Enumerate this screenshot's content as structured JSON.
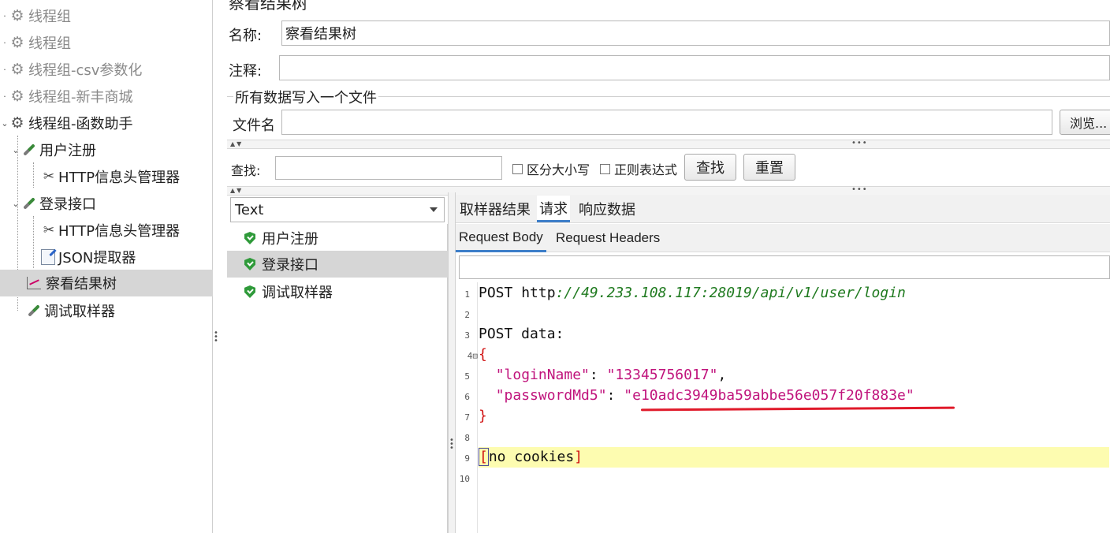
{
  "tree": {
    "items": [
      {
        "label": "线程组",
        "icon": "gear-icon",
        "state": "disabled"
      },
      {
        "label": "线程组",
        "icon": "gear-icon",
        "state": "disabled"
      },
      {
        "label": "线程组-csv参数化",
        "icon": "gear-icon",
        "state": "disabled"
      },
      {
        "label": "线程组-新丰商城",
        "icon": "gear-icon",
        "state": "disabled"
      },
      {
        "label": "线程组-函数助手",
        "icon": "gear-icon",
        "state": "expanded"
      },
      {
        "label": "用户注册",
        "icon": "pipette-icon",
        "state": "expanded"
      },
      {
        "label": "HTTP信息头管理器",
        "icon": "tools-icon",
        "state": "leaf"
      },
      {
        "label": "登录接口",
        "icon": "pipette-icon",
        "state": "expanded"
      },
      {
        "label": "HTTP信息头管理器",
        "icon": "tools-icon",
        "state": "leaf"
      },
      {
        "label": "JSON提取器",
        "icon": "json-extractor-icon",
        "state": "leaf"
      },
      {
        "label": "察看结果树",
        "icon": "graph-icon",
        "state": "selected"
      },
      {
        "label": "调试取样器",
        "icon": "pipette-icon",
        "state": "leaf"
      }
    ]
  },
  "panel": {
    "title": "察看结果树",
    "name_label": "名称:",
    "name_value": "察看结果树",
    "comment_label": "注释:",
    "comment_value": "",
    "group_title": "所有数据写入一个文件",
    "filename_label": "文件名",
    "filename_value": "",
    "browse_button": "浏览..."
  },
  "search": {
    "label": "查找:",
    "value": "",
    "case_sensitive": "区分大小写",
    "regex": "正则表达式",
    "find_button": "查找",
    "reset_button": "重置"
  },
  "results": {
    "render_mode": "Text",
    "samples": [
      {
        "label": "用户注册",
        "status": "success"
      },
      {
        "label": "登录接口",
        "status": "success",
        "selected": true
      },
      {
        "label": "调试取样器",
        "status": "success"
      }
    ]
  },
  "tabs": {
    "items": [
      "取样器结果",
      "请求",
      "响应数据"
    ],
    "active": "请求",
    "sub_items": [
      "Request Body",
      "Request Headers"
    ],
    "sub_active": "Request Body"
  },
  "code": {
    "line_numbers": [
      "1",
      "2",
      "3",
      "4⊟",
      "5",
      "6",
      "7",
      "8",
      "9",
      "10"
    ],
    "method": "POST",
    "url_scheme": "http",
    "url_rest": "://49.233.108.117:28019/api/v1/user/login",
    "post_data_label": "POST data:",
    "open_brace": "{",
    "close_brace": "}",
    "key1": "\"loginName\"",
    "val1": "\"13345756017\"",
    "key2": "\"passwordMd5\"",
    "val2": "\"e10adc3949ba59abbe56e057f20f883e\"",
    "cookies_text": "no cookies",
    "annotation_color": "#e01a2a"
  }
}
